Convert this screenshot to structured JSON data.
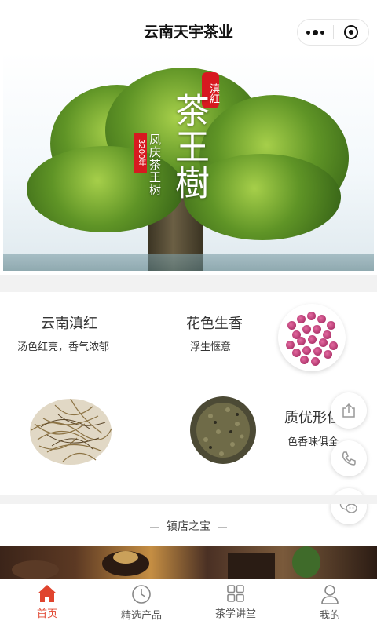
{
  "nav": {
    "title": "云南天宇茶业"
  },
  "banner": {
    "stamp": "滇紅",
    "title": "茶王樹",
    "subtitle": "凤庆茶王树",
    "age": "3200年"
  },
  "features": [
    {
      "title": "云南滇红",
      "desc": "汤色红亮，香气浓郁"
    },
    {
      "title": "花色生香",
      "desc": "浮生惬意"
    },
    {
      "title": "质优形佳",
      "desc": "色香味俱全"
    }
  ],
  "section": {
    "title": "镇店之宝"
  },
  "tabbar": {
    "items": [
      {
        "label": "首页",
        "icon": "home-icon",
        "active": true
      },
      {
        "label": "精选产品",
        "icon": "clock-icon",
        "active": false
      },
      {
        "label": "茶学讲堂",
        "icon": "grid-icon",
        "active": false
      },
      {
        "label": "我的",
        "icon": "user-icon",
        "active": false
      }
    ]
  },
  "colors": {
    "accent": "#e0442e",
    "stamp_red": "#d71920"
  }
}
